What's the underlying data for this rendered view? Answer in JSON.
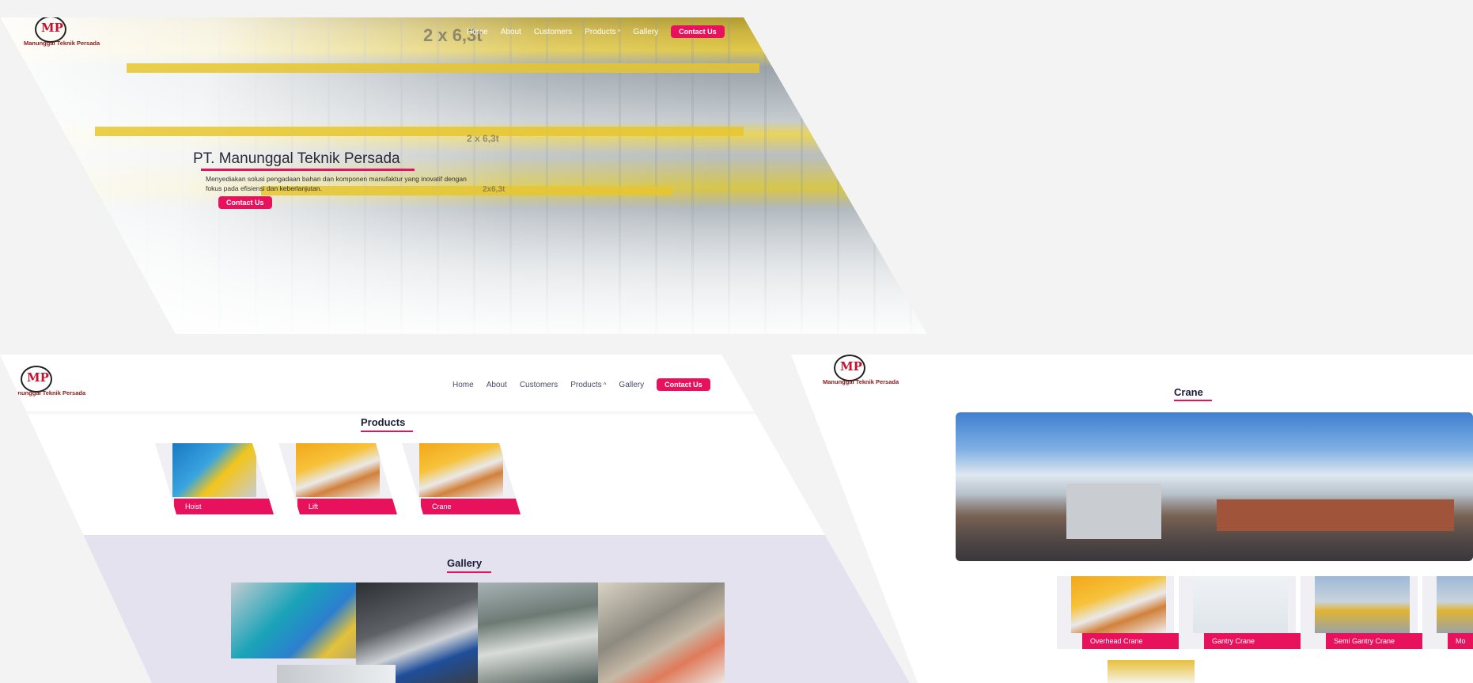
{
  "brand": {
    "logo_mark": "MP",
    "name": "Manunggal Teknik Persada"
  },
  "nav": {
    "items": [
      "Home",
      "About",
      "Customers",
      "Products",
      "Gallery"
    ],
    "products_chevron": "^",
    "contact": "Contact Us"
  },
  "hero": {
    "title": "PT. Manunggal Teknik Persada",
    "description": "Menyediakan solusi pengadaan bahan dan komponen manufaktur yang inovatif dengan fokus pada efisiensi dan keberlanjutan.",
    "button": "Contact Us",
    "photo_label_1": "2 x 6,3t",
    "photo_label_2": "2 x 6,3t",
    "photo_label_3": "2x6,3t"
  },
  "products": {
    "title": "Products",
    "items": [
      "Hoist",
      "Lift",
      "Crane"
    ]
  },
  "gallery": {
    "title": "Gallery"
  },
  "crane_page": {
    "title": "Crane",
    "items": [
      "Overhead Crane",
      "Gantry Crane",
      "Semi Gantry Crane",
      "Mo"
    ]
  },
  "colors": {
    "accent": "#e8125c",
    "gallery_bg": "#e4e2ee",
    "nav_text": "#4a4a6a"
  }
}
